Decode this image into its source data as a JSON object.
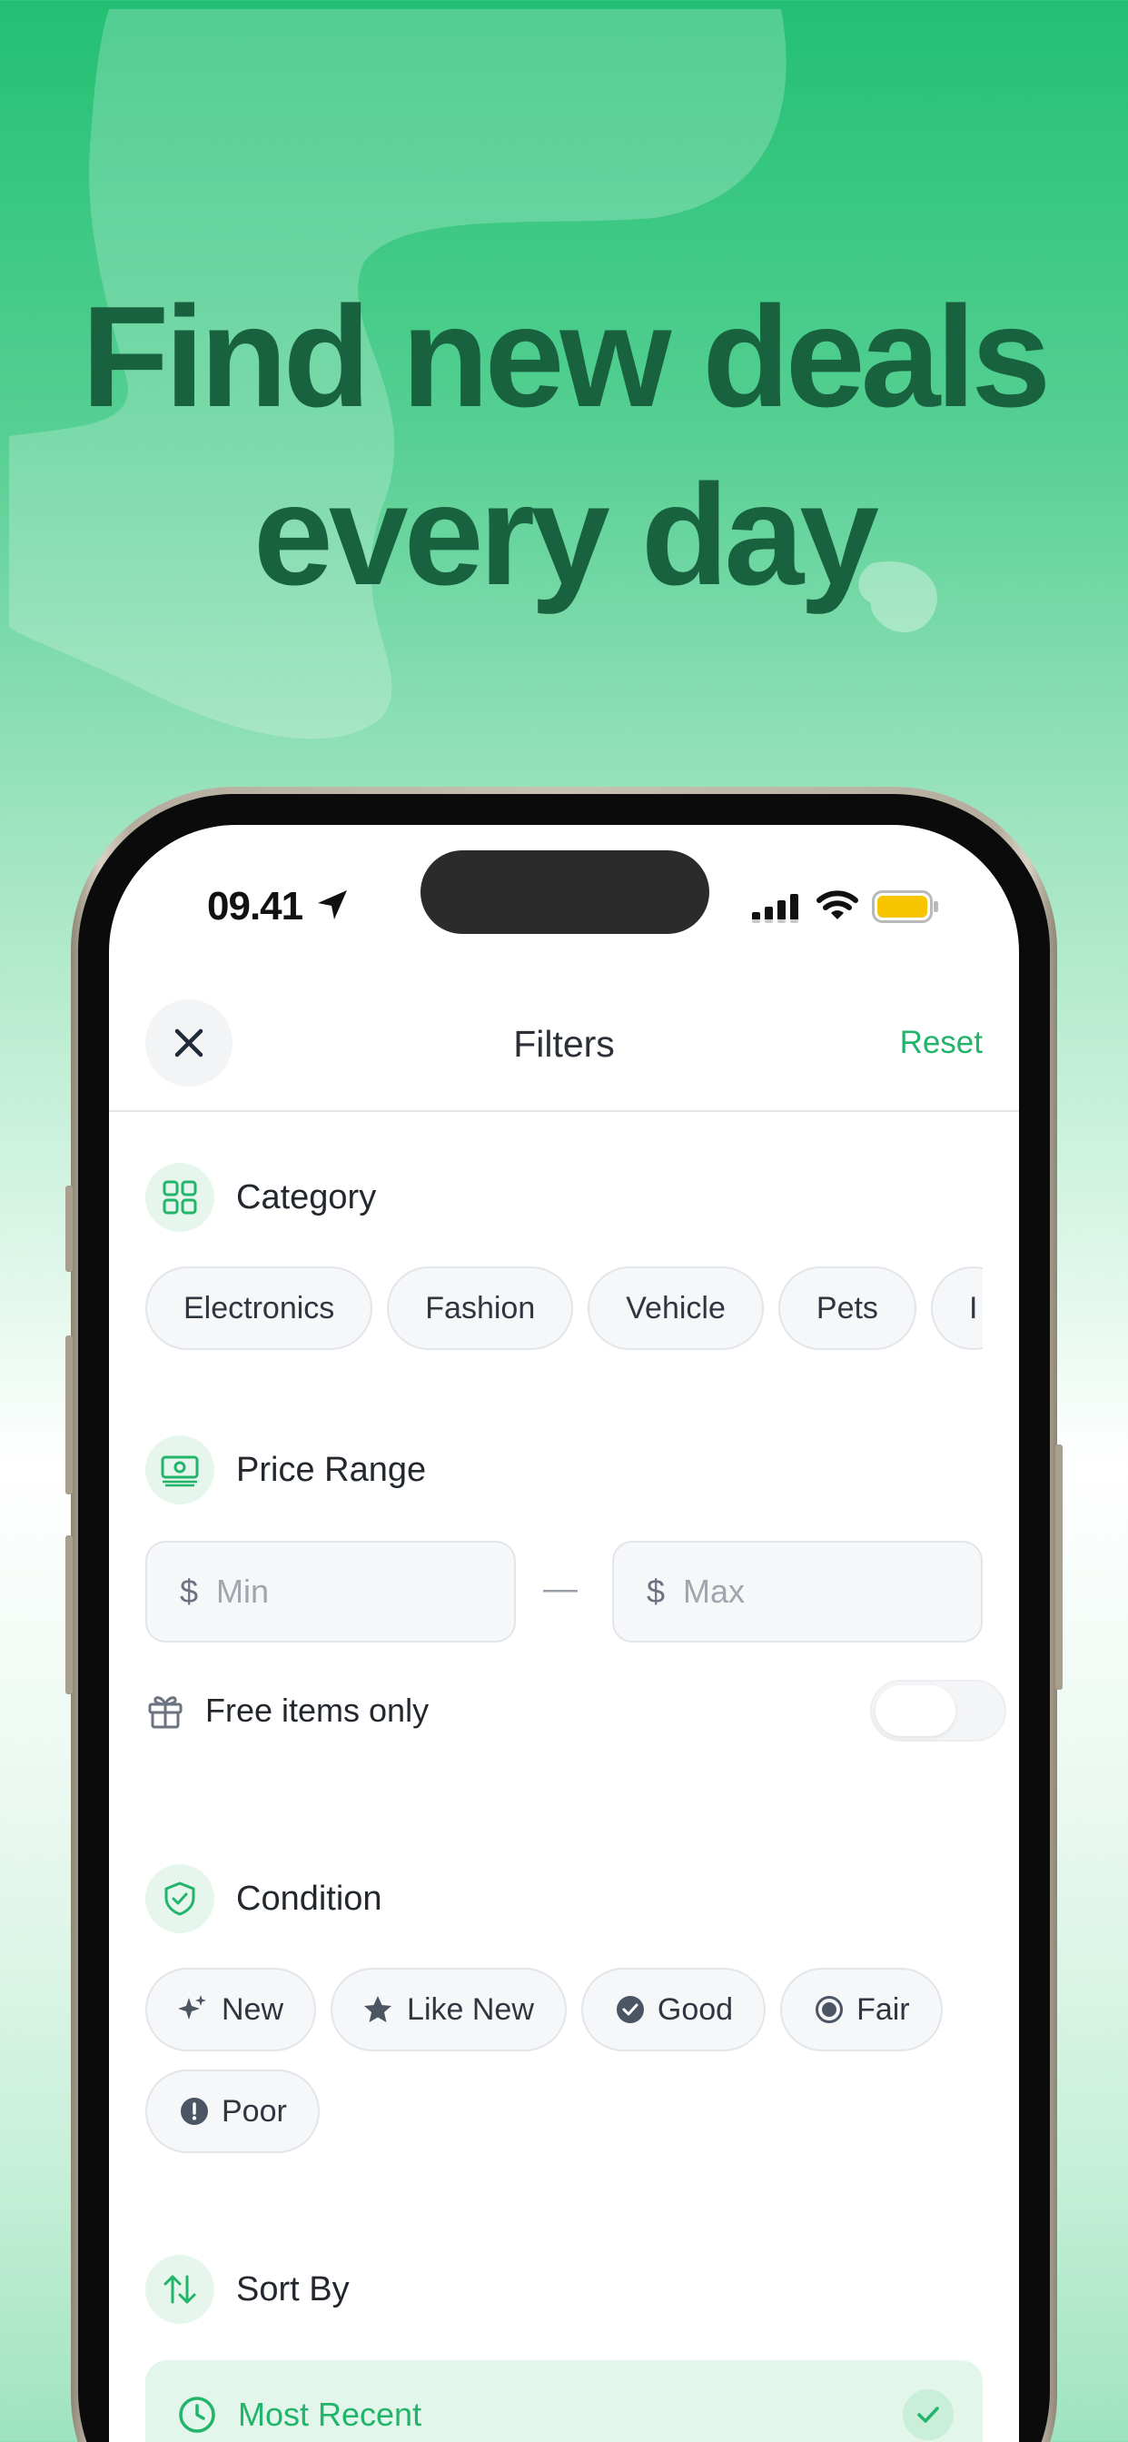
{
  "headline": {
    "line1": "Find new deals",
    "line2": "every day"
  },
  "status_bar": {
    "time": "09.41",
    "battery_color": "#f7c600"
  },
  "nav": {
    "title": "Filters",
    "reset_label": "Reset",
    "close_icon": "close-icon"
  },
  "category": {
    "title": "Category",
    "icon": "grid-icon",
    "chips": [
      "Electronics",
      "Fashion",
      "Vehicle",
      "Pets",
      "I"
    ]
  },
  "price_range": {
    "title": "Price Range",
    "icon": "money-icon",
    "currency_symbol": "$",
    "min_placeholder": "Min",
    "max_placeholder": "Max",
    "separator": "—"
  },
  "free_items": {
    "label": "Free items only",
    "icon": "gift-icon",
    "enabled": false
  },
  "condition": {
    "title": "Condition",
    "icon": "shield-check-icon",
    "chips": [
      {
        "label": "New",
        "icon": "sparkles-icon"
      },
      {
        "label": "Like New",
        "icon": "star-icon"
      },
      {
        "label": "Good",
        "icon": "check-circle-icon"
      },
      {
        "label": "Fair",
        "icon": "radio-icon"
      },
      {
        "label": "Poor",
        "icon": "alert-circle-icon"
      }
    ]
  },
  "sort_by": {
    "title": "Sort By",
    "icon": "sort-arrows-icon",
    "selected_option": "Most Recent"
  },
  "colors": {
    "accent": "#22b46a",
    "headline": "#18623f",
    "accent_tint": "#e3f6eb"
  }
}
